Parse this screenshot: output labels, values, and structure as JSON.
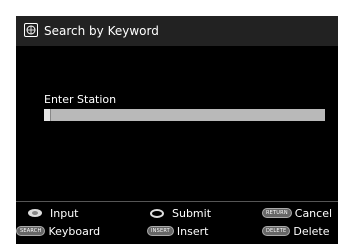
{
  "title": "Search by Keyword",
  "field": {
    "label": "Enter Station",
    "value": ""
  },
  "help": {
    "input": {
      "icon": "dpad-icon",
      "label": "Input"
    },
    "submit": {
      "icon": "enter-icon",
      "label": "Submit"
    },
    "cancel": {
      "badge": "RETURN",
      "label": "Cancel"
    },
    "keyboard": {
      "badge": "SEARCH",
      "label": "Keyboard"
    },
    "insert": {
      "badge": "INSERT",
      "label": "Insert"
    },
    "delete": {
      "badge": "DELETE",
      "label": "Delete"
    }
  }
}
